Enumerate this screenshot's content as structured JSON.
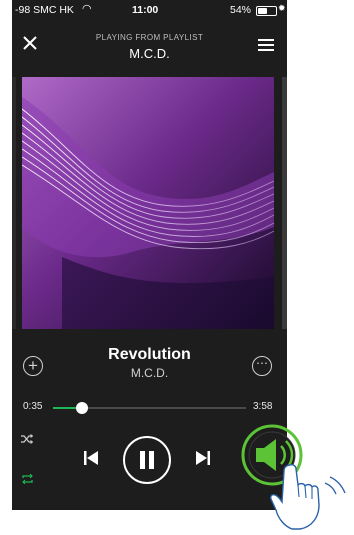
{
  "status_bar": {
    "carrier": "-98 SMC HK",
    "time": "11:00",
    "battery_percent": "54%",
    "battery_level": 0.54
  },
  "header": {
    "subtitle": "PLAYING FROM PLAYLIST",
    "title": "M.C.D."
  },
  "track": {
    "title": "Revolution",
    "artist": "M.C.D."
  },
  "progress": {
    "elapsed": "0:35",
    "total": "3:58",
    "fraction": 0.15
  },
  "player": {
    "repeat_active": true,
    "shuffle_active": false,
    "state": "playing"
  },
  "icons": {
    "close": "close-icon",
    "menu": "menu-icon",
    "add": "add-icon",
    "more": "more-icon",
    "shuffle": "shuffle-icon",
    "repeat": "repeat-icon",
    "previous": "previous-icon",
    "pause": "pause-icon",
    "next": "next-icon",
    "volume": "speaker-icon",
    "pointer": "hand-pointer-icon"
  },
  "colors": {
    "accent": "#1db954",
    "background": "#1d1d1d",
    "art_purple": "#7a2fa0"
  }
}
